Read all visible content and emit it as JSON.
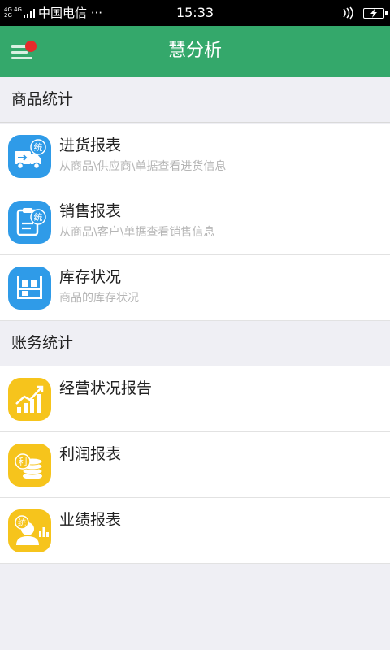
{
  "status_bar": {
    "network_top": "4G 4G",
    "network_bottom": "2G",
    "carrier": "中国电信 ···",
    "time": "15:33"
  },
  "header": {
    "title": "慧分析",
    "menu_icon": "hamburger-icon",
    "notification_color": "#e52b2b",
    "background_color": "#34a86b"
  },
  "sections": [
    {
      "title": "商品统计",
      "items": [
        {
          "title": "进货报表",
          "subtitle": "从商品\\供应商\\单据查看进货信息",
          "icon": "purchase-truck-icon",
          "icon_badge": "统",
          "icon_color": "#2f9be8"
        },
        {
          "title": "销售报表",
          "subtitle": "从商品\\客户\\单据查看销售信息",
          "icon": "sales-clipboard-icon",
          "icon_badge": "统",
          "icon_color": "#2f9be8"
        },
        {
          "title": "库存状况",
          "subtitle": "商品的库存状况",
          "icon": "inventory-shelf-icon",
          "icon_color": "#2f9be8"
        }
      ]
    },
    {
      "title": "账务统计",
      "items": [
        {
          "title": "经营状况报告",
          "subtitle": "",
          "icon": "growth-chart-icon",
          "icon_color": "#f6c41c"
        },
        {
          "title": "利润报表",
          "subtitle": "",
          "icon": "profit-coins-icon",
          "icon_badge": "利",
          "icon_color": "#f6c41c"
        },
        {
          "title": "业绩报表",
          "subtitle": "",
          "icon": "performance-person-icon",
          "icon_badge": "统",
          "icon_color": "#f6c41c"
        }
      ]
    }
  ]
}
